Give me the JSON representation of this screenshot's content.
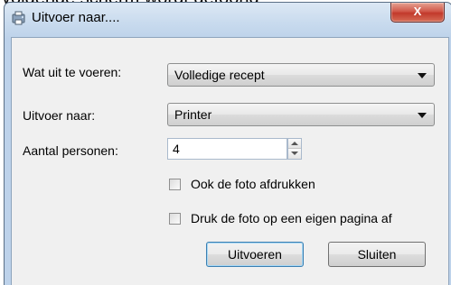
{
  "background_caption": "volgende scherm wordt getoond:",
  "window": {
    "title": "Uitvoer naar....",
    "close_label": "X"
  },
  "form": {
    "what_label": "Wat uit te voeren:",
    "what_value": "Volledige recept",
    "output_label": "Uitvoer naar:",
    "output_value": "Printer",
    "persons_label": "Aantal personen:",
    "persons_value": "4",
    "print_photo_label": "Ook de foto afdrukken",
    "print_photo_checked": false,
    "photo_own_page_label": "Druk de foto op een eigen pagina af",
    "photo_own_page_checked": false
  },
  "buttons": {
    "execute_label": "Uitvoeren",
    "close_label": "Sluiten"
  }
}
